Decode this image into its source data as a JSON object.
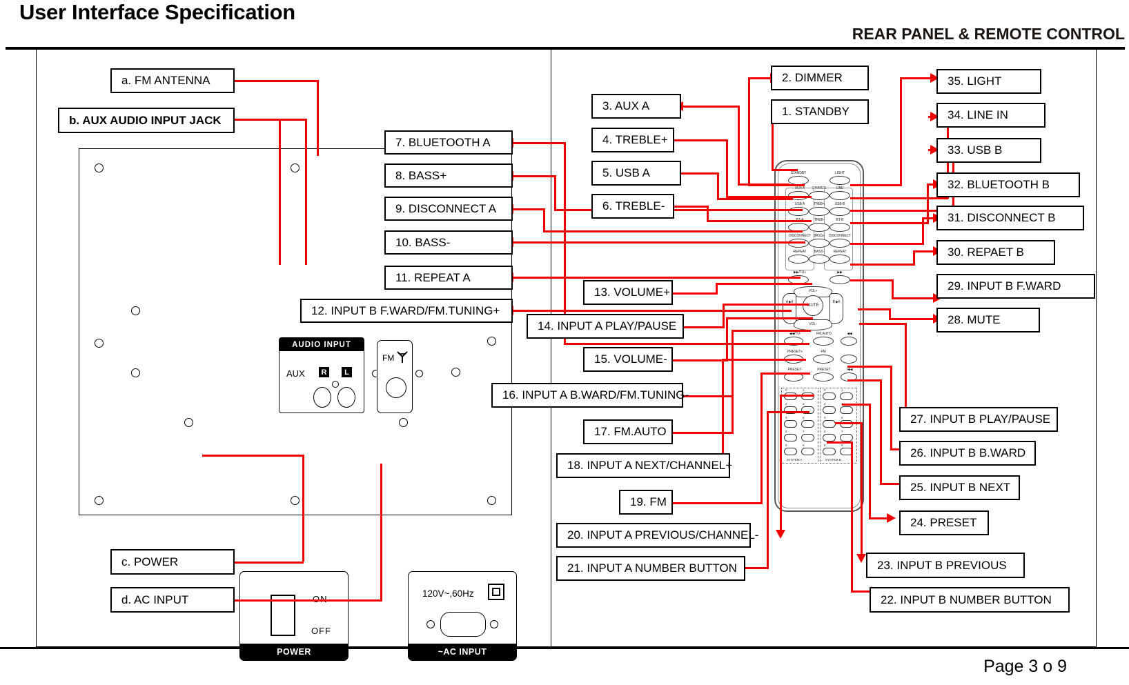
{
  "document": {
    "title": "User Interface Specification",
    "section_title": "REAR PANEL & REMOTE CONTROL",
    "page_footer": "Page 3 o 9"
  },
  "rear_panel_callouts": [
    {
      "id": "a",
      "label": "a.  FM ANTENNA"
    },
    {
      "id": "b",
      "label": "b.  AUX AUDIO INPUT JACK"
    },
    {
      "id": "c",
      "label": "c.  POWER"
    },
    {
      "id": "d",
      "label": "d.  AC INPUT"
    }
  ],
  "remote_callouts": [
    {
      "num": 1,
      "label": "1. STANDBY"
    },
    {
      "num": 2,
      "label": "2. DIMMER"
    },
    {
      "num": 3,
      "label": "3. AUX A"
    },
    {
      "num": 4,
      "label": "4. TREBLE+"
    },
    {
      "num": 5,
      "label": "5. USB A"
    },
    {
      "num": 6,
      "label": "6. TREBLE-"
    },
    {
      "num": 7,
      "label": "7. BLUETOOTH A"
    },
    {
      "num": 8,
      "label": "8. BASS+"
    },
    {
      "num": 9,
      "label": "9. DISCONNECT A"
    },
    {
      "num": 10,
      "label": "10. BASS-"
    },
    {
      "num": 11,
      "label": "11. REPEAT A"
    },
    {
      "num": 12,
      "label": "12. INPUT B F.WARD/FM.TUNING+"
    },
    {
      "num": 13,
      "label": "13. VOLUME+"
    },
    {
      "num": 14,
      "label": "14. INPUT A PLAY/PAUSE"
    },
    {
      "num": 15,
      "label": "15. VOLUME-"
    },
    {
      "num": 16,
      "label": "16. INPUT A B.WARD/FM.TUNING-"
    },
    {
      "num": 17,
      "label": "17. FM.AUTO"
    },
    {
      "num": 18,
      "label": "18. INPUT A NEXT/CHANNEL+"
    },
    {
      "num": 19,
      "label": "19. FM"
    },
    {
      "num": 20,
      "label": "20. INPUT A PREVIOUS/CHANNEL-"
    },
    {
      "num": 21,
      "label": "21. INPUT A NUMBER BUTTON"
    },
    {
      "num": 22,
      "label": "22. INPUT B NUMBER BUTTON"
    },
    {
      "num": 23,
      "label": "23. INPUT B PREVIOUS"
    },
    {
      "num": 24,
      "label": "24. PRESET"
    },
    {
      "num": 25,
      "label": "25. INPUT B NEXT"
    },
    {
      "num": 26,
      "label": "26. INPUT B B.WARD"
    },
    {
      "num": 27,
      "label": "27. INPUT B PLAY/PAUSE"
    },
    {
      "num": 28,
      "label": "28. MUTE"
    },
    {
      "num": 29,
      "label": "29. INPUT B F.WARD"
    },
    {
      "num": 30,
      "label": "30. REPAET B"
    },
    {
      "num": 31,
      "label": "31. DISCONNECT B"
    },
    {
      "num": 32,
      "label": "32. BLUETOOTH B"
    },
    {
      "num": 33,
      "label": "33. USB B"
    },
    {
      "num": 34,
      "label": "34. LINE IN"
    },
    {
      "num": 35,
      "label": "35. LIGHT"
    }
  ],
  "rear_panel": {
    "audio_input": {
      "header": "AUDIO  INPUT",
      "aux_label": "AUX",
      "right_chip": "R",
      "left_chip": "L"
    },
    "fm_connector": {
      "label": "FM"
    },
    "power": {
      "footer": "POWER",
      "on_label": "ON",
      "off_label": "OFF"
    },
    "ac_input": {
      "footer": "~AC INPUT",
      "voltage": "120V~,60Hz"
    }
  },
  "remote": {
    "column_a": [
      "STANDBY",
      "AUX A",
      "USB A",
      "BT-A",
      "DISCONNECT",
      "REPEAT",
      "▶▶/TU+"
    ],
    "column_mid": [
      "DIMMER",
      "TREB+",
      "TREB-",
      "BASS+",
      "BASS-"
    ],
    "column_b": [
      "LIGHT",
      "LINE",
      "USB-B",
      "BT-B",
      "DISCONNECT",
      "REPEAT",
      "▶▶"
    ],
    "dpad": {
      "up": "VOL+",
      "down": "VOL-",
      "left": "A ▶II",
      "center": "MUTE",
      "right": "B ▶II"
    },
    "lower_left": [
      "◀◀/TU-",
      "PRESET+",
      "PRESET-"
    ],
    "lower_mid": [
      "FM.AUTO",
      "FM",
      "PRESET"
    ],
    "lower_right": [
      "◀◀",
      "▶▶I",
      "I◀◀"
    ],
    "numpad_a_title": "SYSTEM A",
    "numpad_b_title": "SYSTEM B",
    "digits": [
      "0",
      "1",
      "2",
      "3",
      "4",
      "5",
      "6",
      "7",
      "8",
      "9"
    ]
  },
  "colors": {
    "connector_red": "#f10000",
    "outline_black": "#000000"
  }
}
